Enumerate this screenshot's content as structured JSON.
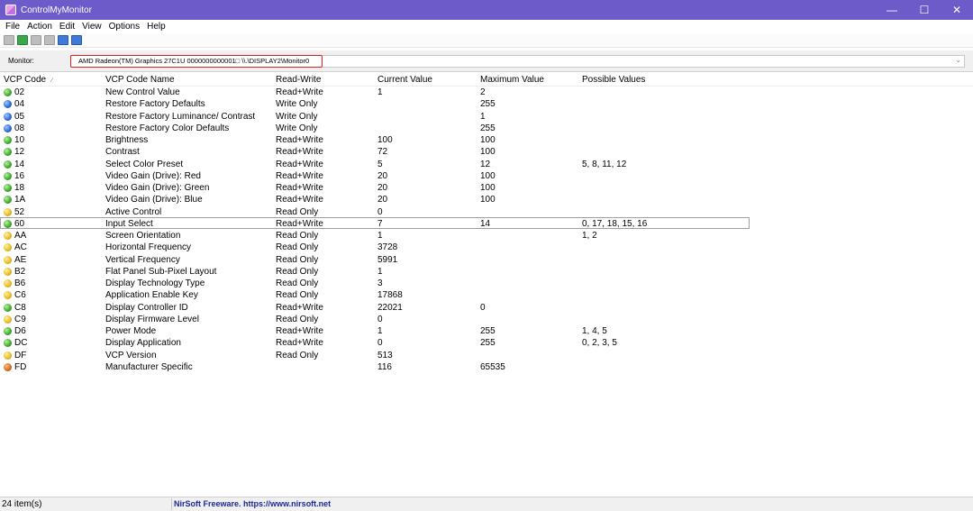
{
  "window": {
    "title": "ControlMyMonitor"
  },
  "menu": [
    "File",
    "Action",
    "Edit",
    "View",
    "Options",
    "Help"
  ],
  "monitor": {
    "label": "Monitor:",
    "value": "AMD Radeon(TM) Graphics  27C1U  0000000000001□  \\\\.\\DISPLAY2\\Monitor0"
  },
  "columns": {
    "vcp_code": "VCP Code",
    "vcp_name": "VCP Code Name",
    "access": "Read-Write",
    "current": "Current Value",
    "maximum": "Maximum Value",
    "possible": "Possible Values"
  },
  "rows": [
    {
      "code": "02",
      "name": "New Control Value",
      "access": "Read+Write",
      "current": "1",
      "max": "2",
      "possible": "",
      "status": "green"
    },
    {
      "code": "04",
      "name": "Restore Factory Defaults",
      "access": "Write Only",
      "current": "",
      "max": "255",
      "possible": "",
      "status": "blue"
    },
    {
      "code": "05",
      "name": "Restore Factory Luminance/ Contrast",
      "access": "Write Only",
      "current": "",
      "max": "1",
      "possible": "",
      "status": "blue"
    },
    {
      "code": "08",
      "name": "Restore Factory Color Defaults",
      "access": "Write Only",
      "current": "",
      "max": "255",
      "possible": "",
      "status": "blue"
    },
    {
      "code": "10",
      "name": "Brightness",
      "access": "Read+Write",
      "current": "100",
      "max": "100",
      "possible": "",
      "status": "green"
    },
    {
      "code": "12",
      "name": "Contrast",
      "access": "Read+Write",
      "current": "72",
      "max": "100",
      "possible": "",
      "status": "green"
    },
    {
      "code": "14",
      "name": "Select Color Preset",
      "access": "Read+Write",
      "current": "5",
      "max": "12",
      "possible": "5, 8, 11, 12",
      "status": "green"
    },
    {
      "code": "16",
      "name": "Video Gain (Drive): Red",
      "access": "Read+Write",
      "current": "20",
      "max": "100",
      "possible": "",
      "status": "green"
    },
    {
      "code": "18",
      "name": "Video Gain (Drive): Green",
      "access": "Read+Write",
      "current": "20",
      "max": "100",
      "possible": "",
      "status": "green"
    },
    {
      "code": "1A",
      "name": "Video Gain (Drive): Blue",
      "access": "Read+Write",
      "current": "20",
      "max": "100",
      "possible": "",
      "status": "green"
    },
    {
      "code": "52",
      "name": "Active Control",
      "access": "Read Only",
      "current": "0",
      "max": "",
      "possible": "",
      "status": "yellow"
    },
    {
      "code": "60",
      "name": "Input Select",
      "access": "Read+Write",
      "current": "7",
      "max": "14",
      "possible": "0, 17, 18, 15, 16",
      "status": "green"
    },
    {
      "code": "AA",
      "name": "Screen Orientation",
      "access": "Read Only",
      "current": "1",
      "max": "",
      "possible": "1, 2",
      "status": "yellow"
    },
    {
      "code": "AC",
      "name": "Horizontal Frequency",
      "access": "Read Only",
      "current": "3728",
      "max": "",
      "possible": "",
      "status": "yellow"
    },
    {
      "code": "AE",
      "name": "Vertical Frequency",
      "access": "Read Only",
      "current": "5991",
      "max": "",
      "possible": "",
      "status": "yellow"
    },
    {
      "code": "B2",
      "name": "Flat Panel Sub-Pixel Layout",
      "access": "Read Only",
      "current": "1",
      "max": "",
      "possible": "",
      "status": "yellow"
    },
    {
      "code": "B6",
      "name": "Display Technology Type",
      "access": "Read Only",
      "current": "3",
      "max": "",
      "possible": "",
      "status": "yellow"
    },
    {
      "code": "C6",
      "name": "Application Enable Key",
      "access": "Read Only",
      "current": "17868",
      "max": "",
      "possible": "",
      "status": "yellow"
    },
    {
      "code": "C8",
      "name": "Display Controller ID",
      "access": "Read+Write",
      "current": "22021",
      "max": "0",
      "possible": "",
      "status": "green"
    },
    {
      "code": "C9",
      "name": "Display Firmware Level",
      "access": "Read Only",
      "current": "0",
      "max": "",
      "possible": "",
      "status": "yellow"
    },
    {
      "code": "D6",
      "name": "Power Mode",
      "access": "Read+Write",
      "current": "1",
      "max": "255",
      "possible": "1, 4, 5",
      "status": "green"
    },
    {
      "code": "DC",
      "name": "Display Application",
      "access": "Read+Write",
      "current": "0",
      "max": "255",
      "possible": "0, 2, 3, 5",
      "status": "green"
    },
    {
      "code": "DF",
      "name": "VCP Version",
      "access": "Read Only",
      "current": "513",
      "max": "",
      "possible": "",
      "status": "yellow"
    },
    {
      "code": "FD",
      "name": "Manufacturer Specific",
      "access": "",
      "current": "116",
      "max": "65535",
      "possible": "",
      "status": "orange"
    }
  ],
  "selected_row_index": 11,
  "statusbar": {
    "count": "24 item(s)",
    "link": "NirSoft Freeware. https://www.nirsoft.net"
  },
  "colors": {
    "titlebar": "#6c5bc9",
    "highlight_border": "#e02020",
    "link": "#1a2a9a"
  }
}
